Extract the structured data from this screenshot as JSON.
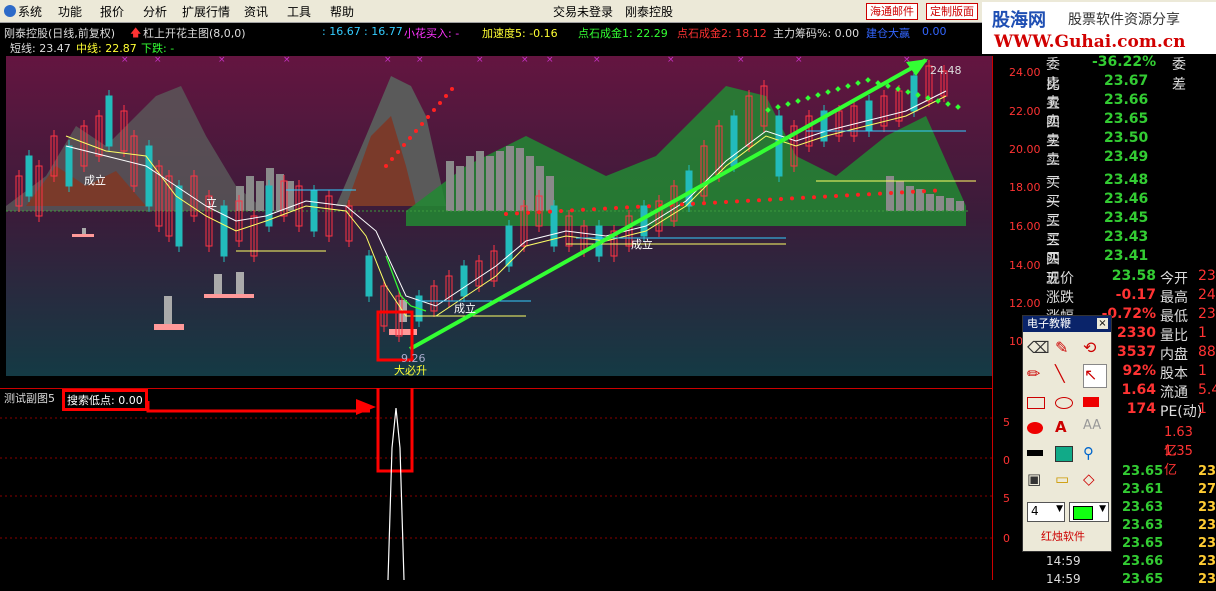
{
  "menu": [
    "系统",
    "功能",
    "报价",
    "分析",
    "扩展行情",
    "资讯",
    "工具",
    "帮助"
  ],
  "login_status": "交易未登录",
  "app_name": "刚泰控股",
  "topbuttons": [
    "海通邮件",
    "定制版面"
  ],
  "logo": {
    "line1": "股海网",
    "line2": "股票软件资源分享",
    "line3": "WWW.Guhai.com.cn"
  },
  "header": {
    "stock": "刚泰控股(日线,前复权)",
    "indicator": "杠上开花主图(8,0,0)",
    "v1": ": 16.67",
    "v2": ": 16.77",
    "buy_label": "小花买入: -",
    "accel": "加速度5: -0.16",
    "gold1": "点石成金1: 22.29",
    "gold2": "点石成金2: 18.12",
    "chip": "主力筹码%: 0.00",
    "big": "建仓大赢",
    "big_val": "0.00"
  },
  "line2": {
    "short": "短线: 23.47",
    "mid": "中线: 22.87",
    "down": "下跌: -"
  },
  "chart_labels": {
    "price_high": "24.48",
    "price_low": "9.26",
    "must_rise": "大必升",
    "cheng1": "成立",
    "cheng2": "立",
    "cheng3": "成立",
    "cheng4": "成立",
    "marker": "§"
  },
  "sub": {
    "name": "测试副图5",
    "search": "搜索低点: 0.00"
  },
  "axis": [
    "24.00",
    "22.00",
    "20.00",
    "18.00",
    "16.00",
    "14.00",
    "12.00",
    "10"
  ],
  "axis_low": [
    "5",
    "0",
    "5",
    "0"
  ],
  "quote": {
    "webi": "委比",
    "webi_val": "-36.22%",
    "wecha": "委差",
    "asks": [
      [
        "卖五",
        "23.67"
      ],
      [
        "卖四",
        "23.66"
      ],
      [
        "卖三",
        "23.65"
      ],
      [
        "卖二",
        "23.50"
      ],
      [
        "卖一",
        "23.49"
      ]
    ],
    "bids": [
      [
        "买一",
        "23.48"
      ],
      [
        "买二",
        "23.46"
      ],
      [
        "买三",
        "23.45"
      ],
      [
        "买四",
        "23.43"
      ],
      [
        "买五",
        "23.41"
      ]
    ],
    "stats": [
      [
        "现价",
        "23.58",
        "今开",
        "23"
      ],
      [
        "涨跌",
        "-0.17",
        "最高",
        "24"
      ],
      [
        "涨幅",
        "-0.72%",
        "最低",
        "23"
      ],
      [
        "",
        "2330",
        "量比",
        "1"
      ],
      [
        "",
        "3537",
        "内盘",
        "88"
      ],
      [
        "",
        "92%",
        "股本",
        "1"
      ],
      [
        "",
        "1.64",
        "流通",
        "5.4"
      ],
      [
        "",
        "174",
        "PE(动)",
        "1"
      ]
    ],
    "amounts": [
      "1.63亿",
      "1.35亿"
    ],
    "ticks": [
      [
        "",
        "23.65",
        "23"
      ],
      [
        "",
        "23.61",
        "27"
      ],
      [
        "",
        "23.63",
        "23"
      ],
      [
        "",
        "23.63",
        "23"
      ],
      [
        "",
        "23.65",
        "23"
      ],
      [
        "14:59",
        "23.66",
        "23"
      ],
      [
        "14:59",
        "23.65",
        "23"
      ]
    ]
  },
  "palette": {
    "title": "电子教鞭",
    "color_value": "4",
    "footer": "红烛软件"
  },
  "colors": {
    "accent_red": "#cc0000",
    "up": "#ff3333",
    "down": "#33cc33",
    "teal": "#1fa0a0",
    "magenta_bg": "#5a1238"
  }
}
